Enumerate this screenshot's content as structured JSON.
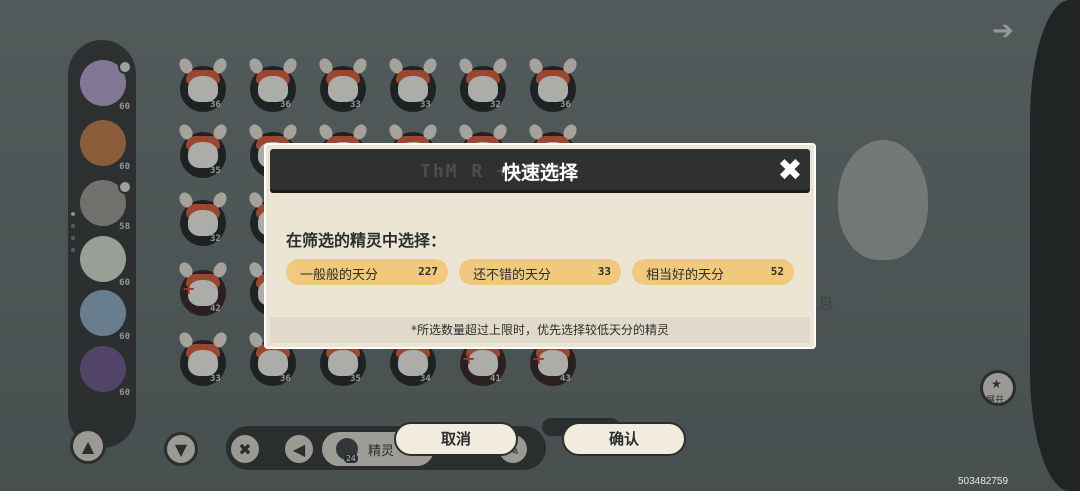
{
  "sidebar": {
    "pets": [
      {
        "name": "sidebar-pet-1",
        "level": "60",
        "color": "#b9a4d6"
      },
      {
        "name": "sidebar-pet-2",
        "level": "60",
        "color": "#c9763d"
      },
      {
        "name": "sidebar-pet-3",
        "level": "58",
        "color": "#9e9a93"
      },
      {
        "name": "sidebar-pet-4",
        "level": "60",
        "color": "#dfe6d8"
      },
      {
        "name": "sidebar-pet-5",
        "level": "60",
        "color": "#8fb0cc"
      },
      {
        "name": "sidebar-pet-6",
        "level": "60",
        "color": "#6b4e8c"
      }
    ]
  },
  "grid": {
    "rows": [
      [
        "36",
        "36",
        "33",
        "33",
        "32",
        "36"
      ],
      [
        "35",
        "",
        "",
        "",
        "",
        ""
      ],
      [
        "32",
        ""
      ],
      [
        "42",
        ""
      ],
      [
        "33",
        "36",
        "35",
        "34",
        "41",
        "43"
      ]
    ]
  },
  "toolbar": {
    "filter_label": "精灵",
    "filter_count": "24",
    "expand_label": "展开"
  },
  "bubble_text": "息",
  "dialog": {
    "deco_text": "ThM R          +XMMM",
    "title": "快速选择",
    "prompt": "在筛选的精灵中选择：",
    "options": [
      {
        "label": "一般般的天分",
        "count": "227"
      },
      {
        "label": "还不错的天分",
        "count": "33"
      },
      {
        "label": "相当好的天分",
        "count": "52"
      }
    ],
    "note": "*所选数量超过上限时，优先选择较低天分的精灵",
    "cancel_label": "取消",
    "confirm_label": "确认"
  },
  "uid": "503482759",
  "colors": {
    "accent": "#f1c97c",
    "dialog_bg": "#ece5d4",
    "header_bg": "#2e3031"
  }
}
